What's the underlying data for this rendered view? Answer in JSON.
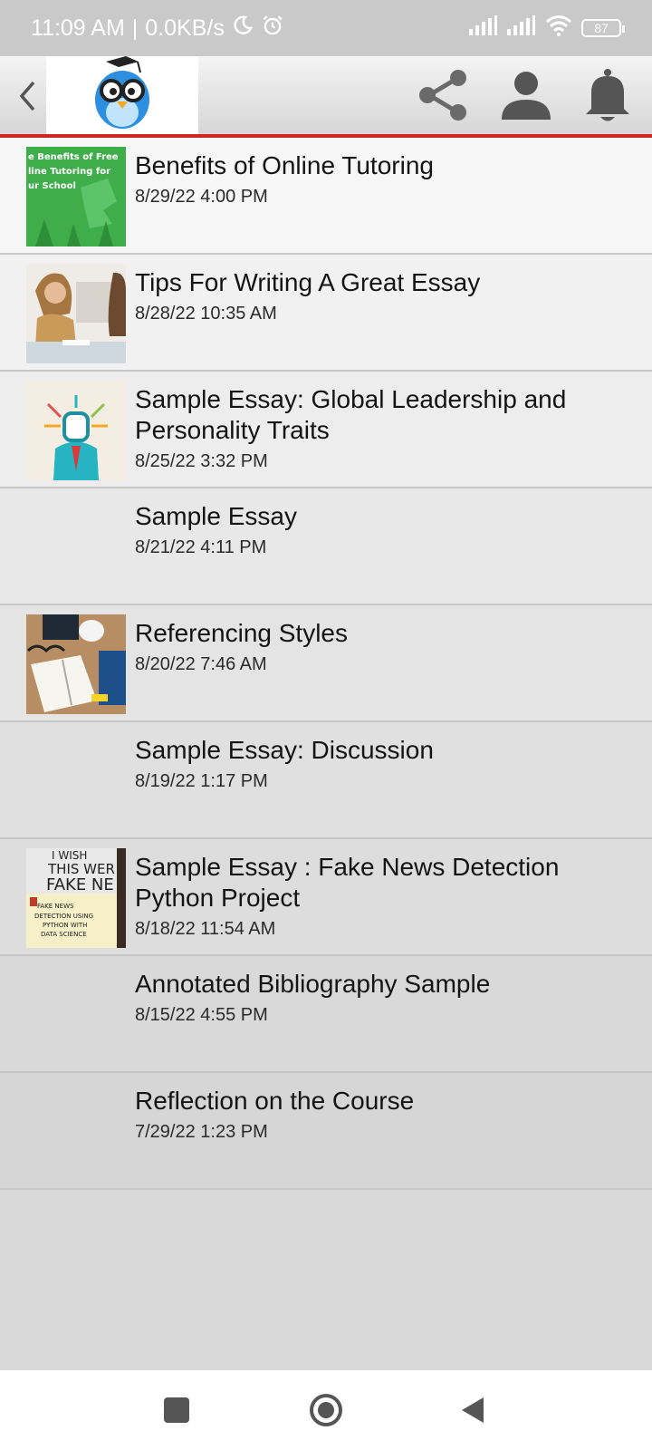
{
  "status_bar": {
    "time": "11:09 AM",
    "speed": "0.0KB/s",
    "battery": "87",
    "icons": [
      "moon-icon",
      "alarm-icon",
      "signal-icon",
      "signal-icon",
      "wifi-icon",
      "battery-icon"
    ]
  },
  "header": {
    "icons": [
      "back-icon",
      "bird-logo-icon",
      "share-icon",
      "profile-icon",
      "bell-icon"
    ],
    "accent_color": "#d32424"
  },
  "items": [
    {
      "title": "Benefits of Online Tutoring",
      "date": "8/29/22 4:00 PM",
      "thumb_lines": [
        "e Benefits of Free",
        "line Tutoring for",
        "ur School"
      ]
    },
    {
      "title": "Tips For Writing A Great Essay",
      "date": "8/28/22 10:35 AM"
    },
    {
      "title": "Sample Essay: Global Leadership and Personality Traits",
      "date": "8/25/22 3:32 PM"
    },
    {
      "title": "Sample Essay",
      "date": "8/21/22 4:11 PM"
    },
    {
      "title": "Referencing Styles",
      "date": "8/20/22 7:46 AM"
    },
    {
      "title": "Sample Essay: Discussion",
      "date": "8/19/22 1:17 PM"
    },
    {
      "title": "Sample Essay : Fake News Detection Python Project",
      "date": "8/18/22 11:54 AM",
      "thumb_lines": [
        "I WISH",
        "THIS WER",
        "FAKE NE",
        "FAKE NEWS",
        "DETECTION USING",
        "PYTHON WITH",
        "DATA SCIENCE"
      ]
    },
    {
      "title": "Annotated Bibliography Sample",
      "date": "8/15/22 4:55 PM"
    },
    {
      "title": "Reflection on the Course",
      "date": "7/29/22 1:23 PM"
    }
  ],
  "nav_bar": {
    "icons": [
      "recents-icon",
      "home-icon",
      "back-nav-icon"
    ]
  }
}
